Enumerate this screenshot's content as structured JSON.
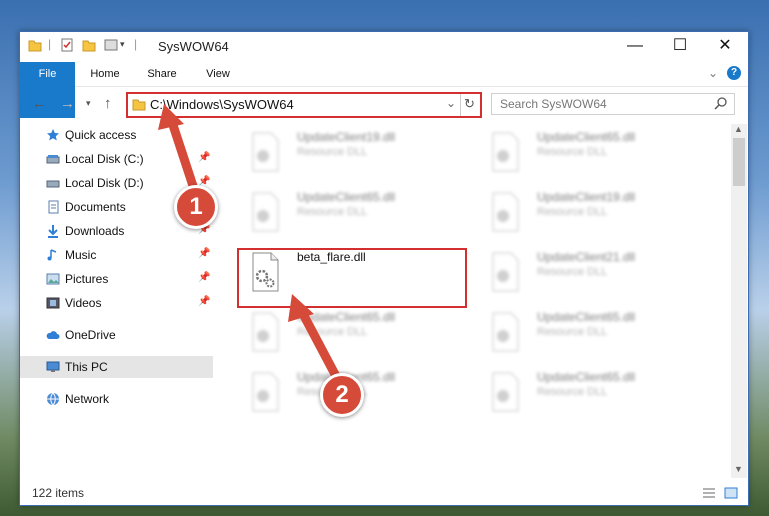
{
  "window": {
    "title": "SysWOW64",
    "minimize": "—",
    "maximize": "☐",
    "close": "✕"
  },
  "ribbon": {
    "tabs": [
      "File",
      "Home",
      "Share",
      "View"
    ],
    "expand_icon": "chevron-down-icon",
    "help_label": "?"
  },
  "address": {
    "path": "C:\\Windows\\SysWOW64",
    "search_placeholder": "Search SysWOW64"
  },
  "sidebar": {
    "items": [
      {
        "label": "Quick access",
        "icon": "star-icon",
        "pinned": false
      },
      {
        "label": "Local Disk (C:)",
        "icon": "drive-icon",
        "pinned": true
      },
      {
        "label": "Local Disk (D:)",
        "icon": "drive-icon",
        "pinned": true
      },
      {
        "label": "Documents",
        "icon": "document-icon",
        "pinned": true
      },
      {
        "label": "Downloads",
        "icon": "download-icon",
        "pinned": true
      },
      {
        "label": "Music",
        "icon": "music-icon",
        "pinned": true
      },
      {
        "label": "Pictures",
        "icon": "pictures-icon",
        "pinned": true
      },
      {
        "label": "Videos",
        "icon": "video-icon",
        "pinned": true
      },
      {
        "label": "OneDrive",
        "icon": "cloud-icon",
        "pinned": false
      },
      {
        "label": "This PC",
        "icon": "computer-icon",
        "pinned": false,
        "selected": true
      },
      {
        "label": "Network",
        "icon": "network-icon",
        "pinned": false
      }
    ]
  },
  "files": [
    {
      "name": "UpdateClient19.dll",
      "type": "Resource DLL",
      "blurred": true
    },
    {
      "name": "UpdateClient65.dll",
      "type": "Resource DLL",
      "blurred": true
    },
    {
      "name": "UpdateClient65.dll",
      "type": "Resource DLL",
      "blurred": true
    },
    {
      "name": "UpdateClient19.dll",
      "type": "Resource DLL",
      "blurred": true
    },
    {
      "name": "beta_flare.dll",
      "type": "",
      "blurred": false
    },
    {
      "name": "UpdateClient21.dll",
      "type": "Resource DLL",
      "blurred": true
    },
    {
      "name": "UpdateClient65.dll",
      "type": "Resource DLL",
      "blurred": true
    },
    {
      "name": "UpdateClient65.dll",
      "type": "Resource DLL",
      "blurred": true
    },
    {
      "name": "UpdateClient65.dll",
      "type": "Resource DLL",
      "blurred": true
    },
    {
      "name": "UpdateClient65.dll",
      "type": "Resource DLL",
      "blurred": true
    }
  ],
  "status": {
    "item_count": "122 items"
  },
  "callouts": [
    "1",
    "2"
  ],
  "colors": {
    "accent": "#1979ca",
    "highlight": "#d32f2f",
    "callout": "#d64a3a"
  }
}
